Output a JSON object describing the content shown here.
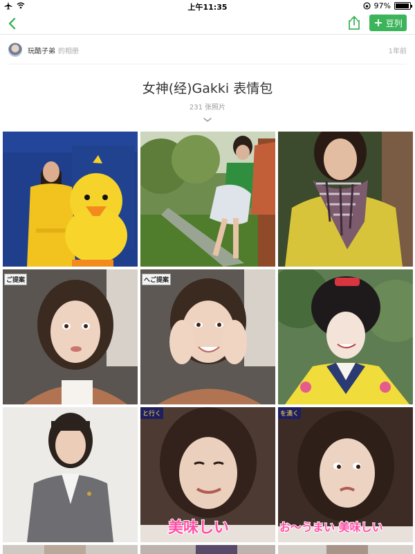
{
  "status_bar": {
    "time": "上午11:35",
    "battery_text": "97%",
    "battery_level": 0.97
  },
  "nav": {
    "back_icon": "chevron-left-icon",
    "share_icon": "share-icon",
    "doulie_label": "豆列",
    "accent_color": "#3cb45a"
  },
  "owner": {
    "name": "玩酷子弟",
    "suffix": "的相册",
    "time": "1年前"
  },
  "album": {
    "title": "女神(经)Gakki 表情包",
    "count": "231 张照片"
  },
  "photos": [
    {
      "id": "p1",
      "alt": "yellow-dress-chick"
    },
    {
      "id": "p2",
      "alt": "garden-scene"
    },
    {
      "id": "p3",
      "alt": "scarf-yellow-coat"
    },
    {
      "id": "p4",
      "alt": "studio-surprised",
      "badge": "ご提案"
    },
    {
      "id": "p5",
      "alt": "studio-hands-cheeks",
      "badge": "へご提案"
    },
    {
      "id": "p6",
      "alt": "geisha-costume"
    },
    {
      "id": "p7",
      "alt": "grey-suit"
    },
    {
      "id": "p8",
      "alt": "tasty-caption",
      "caption": "美味しい",
      "corner_text": "と行く"
    },
    {
      "id": "p9",
      "alt": "umai-caption",
      "caption": "お〜うまい 美味しい",
      "corner_text": "を満く"
    }
  ]
}
